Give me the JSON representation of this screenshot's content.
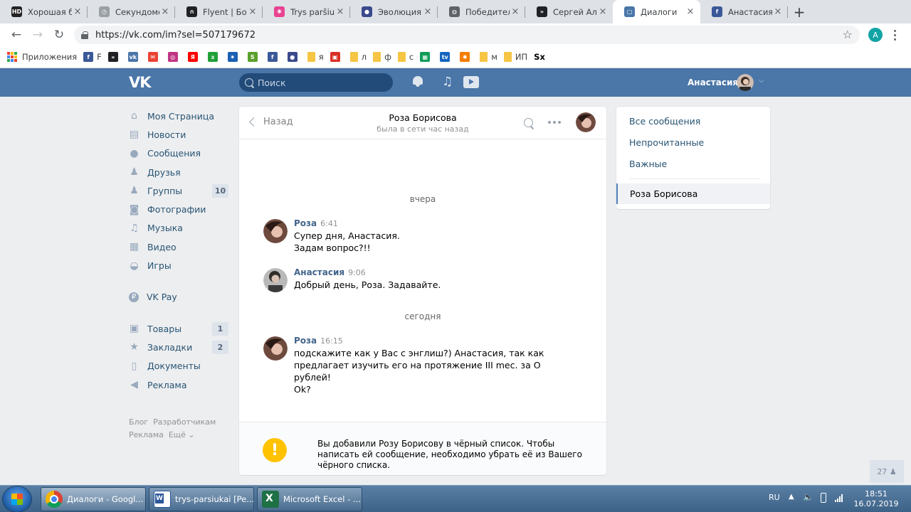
{
  "browser": {
    "tabs": [
      {
        "title": "Хорошая бо",
        "icon": "hd-icon",
        "color": "#222222",
        "glyph": "HD"
      },
      {
        "title": "Секундомер",
        "icon": "stopwatch-icon",
        "color": "#9aa0a6",
        "glyph": "◷"
      },
      {
        "title": "Flyent | Боти",
        "icon": "headphones-icon",
        "color": "#202124",
        "glyph": "∩"
      },
      {
        "title": "Trys paršiuk",
        "icon": "pinwheel-icon",
        "color": "#e84393",
        "glyph": "✱"
      },
      {
        "title": "Эволюция –",
        "icon": "person-icon",
        "color": "#3b4a8c",
        "glyph": "●"
      },
      {
        "title": "Победитель",
        "icon": "globe-icon",
        "color": "#5f6368",
        "glyph": "◍"
      },
      {
        "title": "Сергей Але",
        "icon": "ok-icon",
        "color": "#202124",
        "glyph": "»"
      },
      {
        "title": "Диалоги",
        "icon": "vk-dialog-icon",
        "color": "#4a76a8",
        "glyph": "▢",
        "active": true
      },
      {
        "title": "Анастасия Б",
        "icon": "facebook-icon",
        "color": "#3b5998",
        "glyph": "f"
      }
    ],
    "url": "https://vk.com/im?sel=507179672",
    "profile_initial": "A",
    "bookmarks": [
      {
        "label": "Приложения",
        "icon": "apps-icon",
        "color": "#4285f4",
        "glyph": ""
      },
      {
        "label": "F",
        "icon": "facebook-icon",
        "color": "#3b5998",
        "glyph": "f"
      },
      {
        "label": "",
        "icon": "ok-icon",
        "color": "#202124",
        "glyph": "»"
      },
      {
        "label": "",
        "icon": "vk-icon",
        "color": "#4a76a8",
        "glyph": "vk"
      },
      {
        "label": "",
        "icon": "mail-icon",
        "color": "#ea4335",
        "glyph": "✉"
      },
      {
        "label": "",
        "icon": "instagram-icon",
        "color": "#c13584",
        "glyph": "◎"
      },
      {
        "label": "",
        "icon": "yandex-icon",
        "color": "#ff0000",
        "glyph": "Я"
      },
      {
        "label": "",
        "icon": "sber-icon",
        "color": "#21a038",
        "glyph": "з"
      },
      {
        "label": "",
        "icon": "gerb-icon",
        "color": "#1a5fb4",
        "glyph": "✷"
      },
      {
        "label": "",
        "icon": "s-icon",
        "color": "#5aa02c",
        "glyph": "S"
      },
      {
        "label": "",
        "icon": "facebook-icon",
        "color": "#3b5998",
        "glyph": "f"
      },
      {
        "label": "",
        "icon": "person-icon",
        "color": "#3b4a8c",
        "glyph": "●"
      },
      {
        "label": "я",
        "icon": "folder-icon",
        "color": "#f6c544",
        "glyph": ""
      },
      {
        "label": "",
        "icon": "gift-icon",
        "color": "#d93025",
        "glyph": "▣"
      },
      {
        "label": "л",
        "icon": "folder-icon",
        "color": "#f6c544",
        "glyph": ""
      },
      {
        "label": "ф",
        "icon": "folder-icon",
        "color": "#f6c544",
        "glyph": ""
      },
      {
        "label": "с",
        "icon": "folder-icon",
        "color": "#f6c544",
        "glyph": ""
      },
      {
        "label": "",
        "icon": "green-box-icon",
        "color": "#0f9d58",
        "glyph": "▦"
      },
      {
        "label": "",
        "icon": "tv-icon",
        "color": "#1565c0",
        "glyph": "tv"
      },
      {
        "label": "",
        "icon": "orange-icon",
        "color": "#f57c00",
        "glyph": "✺"
      },
      {
        "label": "м",
        "icon": "folder-icon",
        "color": "#f6c544",
        "glyph": ""
      },
      {
        "label": "ИП",
        "icon": "folder-icon",
        "color": "#f6c544",
        "glyph": ""
      },
      {
        "label": "Sx",
        "icon": "sx-icon",
        "color": "#ffffff",
        "glyph": ""
      }
    ]
  },
  "vk": {
    "logo": "VK",
    "search_placeholder": "Поиск",
    "user_name": "Анастасия",
    "nav": [
      {
        "label": "Моя Страница",
        "icon": "home-icon",
        "glyph": "⌂",
        "badge": ""
      },
      {
        "label": "Новости",
        "icon": "news-icon",
        "glyph": "▤",
        "badge": ""
      },
      {
        "label": "Сообщения",
        "icon": "messages-icon",
        "glyph": "●",
        "badge": ""
      },
      {
        "label": "Друзья",
        "icon": "friends-icon",
        "glyph": "♟",
        "badge": ""
      },
      {
        "label": "Группы",
        "icon": "groups-icon",
        "glyph": "♟",
        "badge": "10"
      },
      {
        "label": "Фотографии",
        "icon": "camera-icon",
        "glyph": "◙",
        "badge": ""
      },
      {
        "label": "Музыка",
        "icon": "music-icon",
        "glyph": "♫",
        "badge": ""
      },
      {
        "label": "Видео",
        "icon": "video-icon",
        "glyph": "▦",
        "badge": ""
      },
      {
        "label": "Игры",
        "icon": "gamepad-icon",
        "glyph": "◒",
        "badge": ""
      },
      {
        "sep": true
      },
      {
        "label": "VK Pay",
        "icon": "vkpay-icon",
        "glyph": "₽",
        "badge": ""
      },
      {
        "sep": true
      },
      {
        "label": "Товары",
        "icon": "bag-icon",
        "glyph": "▣",
        "badge": "1"
      },
      {
        "label": "Закладки",
        "icon": "star-icon",
        "glyph": "★",
        "badge": "2"
      },
      {
        "label": "Документы",
        "icon": "document-icon",
        "glyph": "▯",
        "badge": ""
      },
      {
        "label": "Реклама",
        "icon": "megaphone-icon",
        "glyph": "◀",
        "badge": ""
      }
    ],
    "footer_links": {
      "blog": "Блог",
      "devs": "Разработчикам",
      "ads": "Реклама",
      "more": "Ещё ⌄"
    },
    "chat": {
      "back_label": "Назад",
      "title": "Роза Борисова",
      "status": "была в сети час назад",
      "day1": "вчера",
      "day2": "сегодня",
      "messages": [
        {
          "author": "Роза",
          "time": "6:41",
          "lines": [
            "Супер дня, Анастасия.",
            "Задам вопрос?!!"
          ],
          "avatar": "rosa"
        },
        {
          "author": "Анастасия",
          "time": "9:06",
          "lines": [
            "Добрый день, Роза. Задавайте."
          ],
          "avatar": "anastasia"
        },
        {
          "author": "Роза",
          "time": "16:15",
          "lines": [
            "подскажите как у Вас с энглиш?) Анастасия, так как",
            "предлагает изучить его на протяжение III mec. за O рублей!",
            "Ok?"
          ],
          "avatar": "rosa"
        }
      ],
      "blacklist_notice": "Вы добавили Розу Борисову в чёрный список. Чтобы написать ей сообщение, необходимо убрать её из Вашего чёрного списка.",
      "warning_glyph": "!"
    },
    "right_panel": {
      "all": "Все сообщения",
      "unread": "Непрочитанные",
      "important": "Важные",
      "active_dialog": "Роза Борисова"
    },
    "online_count": "27"
  },
  "taskbar": {
    "buttons": [
      {
        "label": "Диалоги - Googl...",
        "icon": "chrome-icon"
      },
      {
        "label": "trys-parsiukai [Pe...",
        "icon": "word-icon"
      },
      {
        "label": "Microsoft Excel - ...",
        "icon": "excel-icon"
      }
    ],
    "lang": "RU",
    "time": "18:51",
    "date": "16.07.2019"
  }
}
